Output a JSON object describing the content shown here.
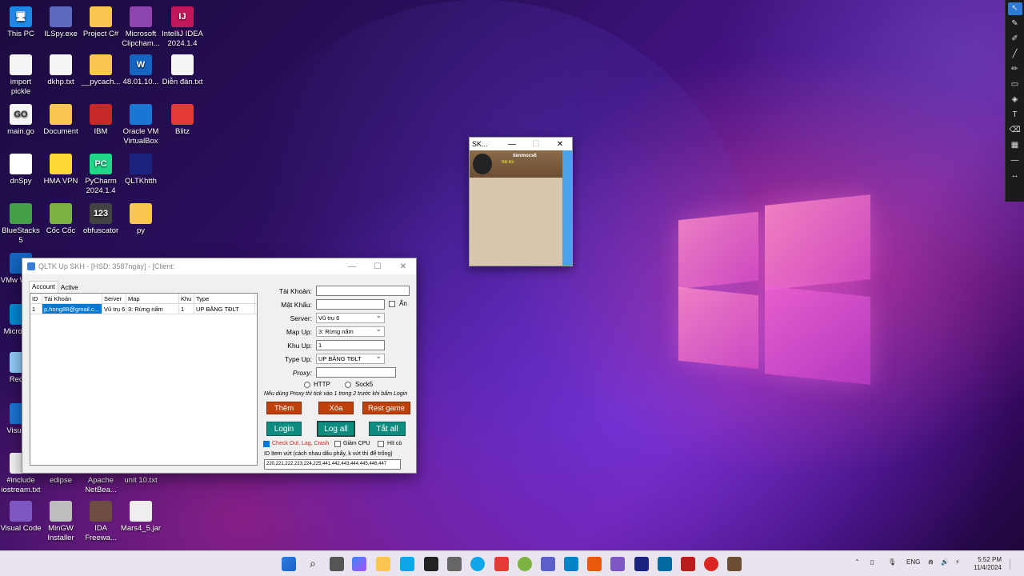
{
  "desktop": {
    "icons": [
      {
        "label": "This PC",
        "color": "#1e88e5",
        "glyph": "🖥"
      },
      {
        "label": "ILSpy.exe",
        "color": "#5c6bc0",
        "glyph": ""
      },
      {
        "label": "Project C#",
        "color": "#f9c74f",
        "glyph": ""
      },
      {
        "label": "Microsoft Clipcham...",
        "color": "#8e44ad",
        "glyph": ""
      },
      {
        "label": "IntelliJ IDEA 2024.1.4",
        "color": "#c2185b",
        "glyph": "IJ"
      },
      {
        "label": "import pickle",
        "color": "#f5f5f5",
        "glyph": ""
      },
      {
        "label": "dkhp.txt",
        "color": "#f5f5f5",
        "glyph": ""
      },
      {
        "label": "__pycach...",
        "color": "#f9c74f",
        "glyph": ""
      },
      {
        "label": "48.01.10...",
        "color": "#1565c0",
        "glyph": "W"
      },
      {
        "label": "Diễn đàn.txt",
        "color": "#f5f5f5",
        "glyph": ""
      },
      {
        "label": "main.go",
        "color": "#f5f5f5",
        "glyph": "GO"
      },
      {
        "label": "Document",
        "color": "#f9c74f",
        "glyph": ""
      },
      {
        "label": "IBM",
        "color": "#c62828",
        "glyph": ""
      },
      {
        "label": "Oracle VM VirtualBox",
        "color": "#1976d2",
        "glyph": ""
      },
      {
        "label": "Blitz",
        "color": "#e53935",
        "glyph": ""
      },
      {
        "label": "dnSpy",
        "color": "#ffffff",
        "glyph": ""
      },
      {
        "label": "HMA VPN",
        "color": "#fdd835",
        "glyph": ""
      },
      {
        "label": "PyCharm 2024.1.4",
        "color": "#21d789",
        "glyph": "PC"
      },
      {
        "label": "QLTKhtth",
        "color": "#1a237e",
        "glyph": ""
      },
      {
        "label": "BlueStacks 5",
        "color": "#43a047",
        "glyph": ""
      },
      {
        "label": "Cốc Cốc",
        "color": "#7cb342",
        "glyph": ""
      },
      {
        "label": "obfuscator",
        "color": "#424242",
        "glyph": "123"
      },
      {
        "label": "py",
        "color": "#f9c74f",
        "glyph": ""
      },
      {
        "label": "VMw Works",
        "color": "#1565c0",
        "glyph": ""
      },
      {
        "label": "Micro Edg",
        "color": "#0288d1",
        "glyph": ""
      },
      {
        "label": "Recycl",
        "color": "#90caf9",
        "glyph": ""
      },
      {
        "label": "Visu Stu",
        "color": "#1976d2",
        "glyph": ""
      },
      {
        "label": "#include iostream.txt",
        "color": "#f5f5f5",
        "glyph": ""
      },
      {
        "label": "edipse",
        "color": "#f9c74f",
        "glyph": ""
      },
      {
        "label": "Apache NetBea...",
        "color": "#f9c74f",
        "glyph": ""
      },
      {
        "label": "unit 10.txt",
        "color": "#f5f5f5",
        "glyph": ""
      },
      {
        "label": "Visual Code",
        "color": "#7e57c2",
        "glyph": ""
      },
      {
        "label": "MinGW Installer",
        "color": "#bdbdbd",
        "glyph": ""
      },
      {
        "label": "IDA Freewa...",
        "color": "#6d4c41",
        "glyph": ""
      },
      {
        "label": "Mars4_5.jar",
        "color": "#eeeeee",
        "glyph": ""
      }
    ]
  },
  "game_window": {
    "title": "SK...",
    "min": "—",
    "max": "☐",
    "close": "✕",
    "player_name": "tienmocs6",
    "player_sub": "Nổi lên"
  },
  "app": {
    "title": "QLTK Up SKH - [HSD: 3587ngày] - [Client:",
    "min": "—",
    "max": "☐",
    "close": "✕",
    "tabs": [
      "Account",
      "Active"
    ],
    "columns": [
      "ID",
      "Tài Khoản",
      "Server",
      "Map",
      "Khu",
      "Type"
    ],
    "rows": [
      [
        "1",
        "p.hong88@gmail.c...",
        "Vũ trụ 6",
        "3: Rừng nấm",
        "1",
        "UP BĂNG TĐLT"
      ]
    ],
    "form": {
      "tai_khoan_label": "Tài Khoản:",
      "tai_khoan_value": "",
      "mat_khau_label": "Mật Khẩu:",
      "an_label": "Ẩn",
      "server_label": "Server:",
      "server_value": "Vũ trụ 6",
      "map_label": "Map Up:",
      "map_value": "3: Rừng nấm",
      "khu_label": "Khu Up:",
      "khu_value": "1",
      "type_label": "Type Up:",
      "type_value": "UP BĂNG TĐLT",
      "proxy_label": "Proxy:",
      "proxy_value": "",
      "http_label": "HTTP",
      "sock5_label": "Sock5",
      "proxy_note": "Nếu dùng Proxy thì tick vào 1 trong 2 trước khi bấm Login",
      "them": "Thêm",
      "xoa": "Xóa",
      "rest": "Rest game",
      "login": "Login",
      "logall": "Log all",
      "tatall": "Tắt all",
      "check_lag": "Check Out, Lag, Crash",
      "giam_cpu": "Giảm CPU",
      "hit_co": "Hít cò",
      "item_label": "ID Item vứt (cách nhau dấu phẩy, k vứt thì để trống)",
      "item_value": "220,221,222,223,224,225,441,442,443,444,445,446,447"
    }
  },
  "taskbar": {
    "time": "5:52 PM",
    "date": "11/4/2024",
    "lang": "ENG"
  },
  "colors": {
    "accent_orange": "#c0400c",
    "accent_teal": "#0f8c80",
    "selection": "#0078d7"
  }
}
